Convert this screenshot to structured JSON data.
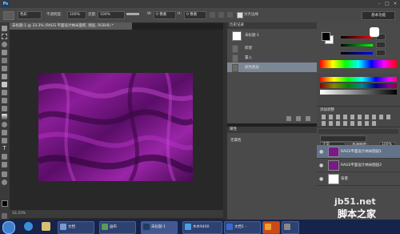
{
  "app": {
    "logo": "Ps",
    "window_controls": [
      "–",
      "□",
      "×"
    ]
  },
  "options_bar": {
    "mode_value": "色彩",
    "opacity_label": "不透明度:",
    "opacity_value": "100%",
    "flow_label": "流量:",
    "flow_value": "100%",
    "w_label": "W:",
    "w_value": "0 像素",
    "h_label": "H:",
    "h_value": "0 像素",
    "checkbox_label": "对齐边缘",
    "workspace": "基本功能"
  },
  "document": {
    "tab_label": "未标题-1 @ 33.3% (RAGS 平面设计纳米面积, 图层, RGB/8) *",
    "status": "33.33%"
  },
  "history": {
    "title": "历史记录",
    "snapshot": "未标题-1",
    "items": [
      "新建",
      "置入",
      "颜色图层"
    ]
  },
  "properties": {
    "title": "属性",
    "content": "无属性"
  },
  "color_panel": {
    "fg": "#000000",
    "bg": "#ffffff"
  },
  "adjustments": {
    "title": "添加调整"
  },
  "layers": {
    "blend_mode": "正常",
    "opacity_label": "不透明度:",
    "opacity_value": "100%",
    "fill_label": "填充:",
    "fill_value": "100%",
    "rows": [
      {
        "name": "RAGS平面设计纳米图层1"
      },
      {
        "name": "RAGS平面设计纳米图层2"
      },
      {
        "name": "背景"
      }
    ]
  },
  "taskbar": {
    "items": [
      "文档",
      "画布",
      "未标题-1",
      "木木9400",
      "文档1 -",
      "",
      ""
    ]
  },
  "watermark": {
    "line1": "jb51.net",
    "line2": "脚本之家"
  }
}
